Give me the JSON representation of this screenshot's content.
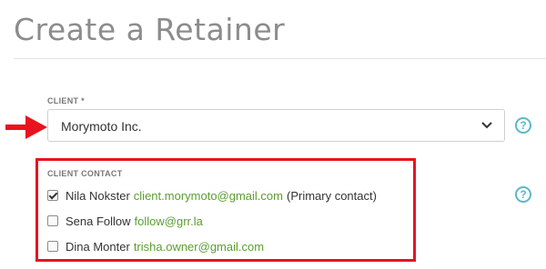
{
  "page": {
    "title": "Create a Retainer"
  },
  "client_field": {
    "label": "CLIENT *",
    "selected_value": "Morymoto Inc.",
    "help_icon": "?"
  },
  "client_contact": {
    "label": "CLIENT CONTACT",
    "help_icon": "?",
    "contacts": [
      {
        "name": "Nila Nokster",
        "email": "client.morymoto@gmail.com",
        "note": "(Primary contact)",
        "checked": true
      },
      {
        "name": "Sena Follow",
        "email": "follow@grr.la",
        "note": "",
        "checked": false
      },
      {
        "name": "Dina Monter",
        "email": "trisha.owner@gmail.com",
        "note": "",
        "checked": false
      }
    ]
  },
  "colors": {
    "highlight_red": "#e8131f",
    "email_green": "#5a9e2d",
    "help_teal": "#5bb8c9",
    "title_gray": "#8c8c8c"
  },
  "icons": {
    "arrow": "red-arrow-icon",
    "chevron": "chevron-down-icon",
    "help": "help-icon"
  }
}
